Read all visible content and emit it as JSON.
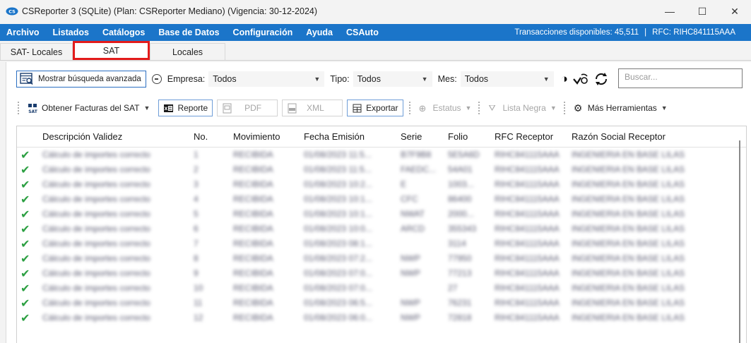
{
  "window": {
    "title": "CSReporter 3 (SQLite) (Plan: CSReporter Mediano) (Vigencia: 30-12-2024)",
    "controls": {
      "minimize": "—",
      "maximize": "☐",
      "close": "✕"
    }
  },
  "menu": {
    "items": [
      "Archivo",
      "Listados",
      "Catálogos",
      "Base de Datos",
      "Configuración",
      "Ayuda",
      "CSAuto"
    ],
    "transacciones": "Transacciones disponibles: 45,511",
    "separator": "|",
    "rfc": "RFC: RIHC841115AAA",
    "bar_color": "#1b75c9"
  },
  "tabs": [
    {
      "label": "SAT- Locales"
    },
    {
      "label": "SAT",
      "selected": true
    },
    {
      "label": "Locales"
    }
  ],
  "filters": {
    "advanced_label": "Mostrar búsqueda avanzada",
    "empresa_label": "Empresa:",
    "empresa_value": "Todos",
    "tipo_label": "Tipo:",
    "tipo_value": "Todos",
    "mes_label": "Mes:",
    "mes_value": "Todos",
    "search_placeholder": "Buscar..."
  },
  "toolbar": {
    "obtener": "Obtener Facturas del SAT",
    "reporte": "Reporte",
    "pdf": "PDF",
    "xml": "XML",
    "exportar": "Exportar",
    "estatus": "Estatus",
    "lista_negra": "Lista Negra",
    "mas_herramientas": "Más Herramientas"
  },
  "table": {
    "columns": [
      "Descripción Validez",
      "No.",
      "Movimiento",
      "Fecha Emisión",
      "Serie",
      "Folio",
      "RFC Receptor",
      "Razón Social Receptor"
    ],
    "rows": [
      {
        "desc": "Cálculo de importes correcto",
        "no": "1",
        "mov": "RECIBIDA",
        "fecha": "01/08/2023 11:5...",
        "serie": "B7F9B8",
        "folio": "5E5A6D",
        "rfc": "RIHC841115AAA",
        "razon": "INGENIERIA EN BASE LILAS"
      },
      {
        "desc": "Cálculo de importes correcto",
        "no": "2",
        "mov": "RECIBIDA",
        "fecha": "01/08/2023 11:5...",
        "serie": "FAEDC...",
        "folio": "54A01",
        "rfc": "RIHC841115AAA",
        "razon": "INGENIERIA EN BASE LILAS"
      },
      {
        "desc": "Cálculo de importes correcto",
        "no": "3",
        "mov": "RECIBIDA",
        "fecha": "01/08/2023 10:2...",
        "serie": "E",
        "folio": "1003...",
        "rfc": "RIHC841115AAA",
        "razon": "INGENIERIA EN BASE LILAS"
      },
      {
        "desc": "Cálculo de importes correcto",
        "no": "4",
        "mov": "RECIBIDA",
        "fecha": "01/08/2023 10:1...",
        "serie": "CFC",
        "folio": "86400",
        "rfc": "RIHC841115AAA",
        "razon": "INGENIERIA EN BASE LILAS"
      },
      {
        "desc": "Cálculo de importes correcto",
        "no": "5",
        "mov": "RECIBIDA",
        "fecha": "01/08/2023 10:1...",
        "serie": "NWAT",
        "folio": "2000...",
        "rfc": "RIHC841115AAA",
        "razon": "INGENIERIA EN BASE LILAS"
      },
      {
        "desc": "Cálculo de importes correcto",
        "no": "6",
        "mov": "RECIBIDA",
        "fecha": "01/08/2023 10:0...",
        "serie": "ARCD",
        "folio": "355343",
        "rfc": "RIHC841115AAA",
        "razon": "INGENIERIA EN BASE LILAS"
      },
      {
        "desc": "Cálculo de importes correcto",
        "no": "7",
        "mov": "RECIBIDA",
        "fecha": "01/08/2023 08:1...",
        "serie": "",
        "folio": "3114",
        "rfc": "RIHC841115AAA",
        "razon": "INGENIERIA EN BASE LILAS"
      },
      {
        "desc": "Cálculo de importes correcto",
        "no": "8",
        "mov": "RECIBIDA",
        "fecha": "01/08/2023 07:2...",
        "serie": "NWP",
        "folio": "77950",
        "rfc": "RIHC841115AAA",
        "razon": "INGENIERIA EN BASE LILAS"
      },
      {
        "desc": "Cálculo de importes correcto",
        "no": "9",
        "mov": "RECIBIDA",
        "fecha": "01/08/2023 07:0...",
        "serie": "NWP",
        "folio": "77213",
        "rfc": "RIHC841115AAA",
        "razon": "INGENIERIA EN BASE LILAS"
      },
      {
        "desc": "Cálculo de importes correcto",
        "no": "10",
        "mov": "RECIBIDA",
        "fecha": "01/08/2023 07:0...",
        "serie": "",
        "folio": "27",
        "rfc": "RIHC841115AAA",
        "razon": "INGENIERIA EN BASE LILAS"
      },
      {
        "desc": "Cálculo de importes correcto",
        "no": "11",
        "mov": "RECIBIDA",
        "fecha": "01/08/2023 06:5...",
        "serie": "NWP",
        "folio": "76231",
        "rfc": "RIHC841115AAA",
        "razon": "INGENIERIA EN BASE LILAS"
      },
      {
        "desc": "Cálculo de importes correcto",
        "no": "12",
        "mov": "RECIBIDA",
        "fecha": "01/08/2023 06:0...",
        "serie": "NWP",
        "folio": "72818",
        "rfc": "RIHC841115AAA",
        "razon": "INGENIERIA EN BASE LILAS"
      }
    ]
  },
  "colors": {
    "accent": "#1b75c9",
    "highlight_tab": "#e31b1b",
    "check": "#2da043"
  }
}
